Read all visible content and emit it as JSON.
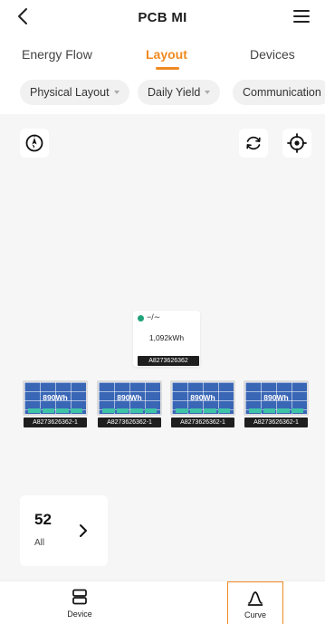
{
  "header": {
    "title": "PCB MI",
    "back_icon": "back-chevron-icon",
    "menu_icon": "hamburger-menu-icon"
  },
  "tabs": [
    {
      "label": "Energy Flow",
      "active": false
    },
    {
      "label": "Layout",
      "active": true
    },
    {
      "label": "Devices",
      "active": false
    }
  ],
  "filters": [
    {
      "label": "Physical Layout"
    },
    {
      "label": "Daily Yield"
    },
    {
      "label": "Communication"
    }
  ],
  "canvas": {
    "compass_icon": "compass-icon",
    "refresh_icon": "refresh-icon",
    "locate_icon": "locate-target-icon",
    "inverter": {
      "symbol": "−/∼",
      "energy": "1,092kWh",
      "id": "A8273626362",
      "status_color": "#20a37a"
    },
    "panels": [
      {
        "energy": "890Wh",
        "id": "A8273626362-1"
      },
      {
        "energy": "890Wh",
        "id": "A8273626362-1"
      },
      {
        "energy": "890Wh",
        "id": "A8273626362-1"
      },
      {
        "energy": "890Wh",
        "id": "A8273626362-1"
      }
    ],
    "summary": {
      "count": "52",
      "label": "All"
    }
  },
  "bottom_nav": [
    {
      "label": "Device",
      "icon": "device-list-icon",
      "active": false
    },
    {
      "label": "Curve",
      "icon": "curve-chart-icon",
      "active": true
    }
  ],
  "colors": {
    "accent": "#f08a21",
    "panel": "#3a66b6",
    "panel_bar": "#3fc3a8"
  }
}
